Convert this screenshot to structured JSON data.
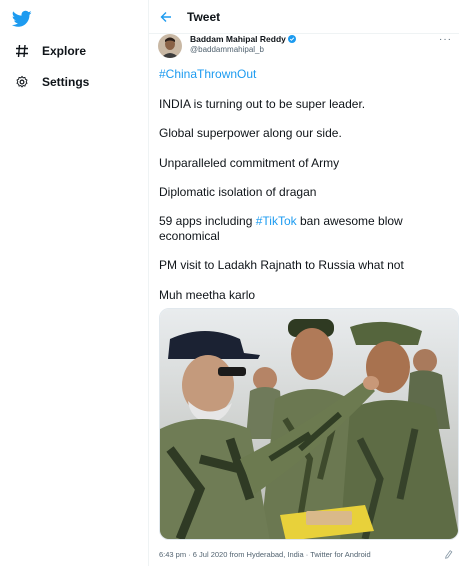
{
  "nav": {
    "items": [
      {
        "label": "Explore",
        "icon": "hash-icon"
      },
      {
        "label": "Settings",
        "icon": "gear-icon"
      }
    ]
  },
  "header": {
    "title": "Tweet"
  },
  "tweet": {
    "author_name": "Baddam Mahipal Reddy",
    "author_handle": "@baddammahipal_b",
    "hashtag_line": "#ChinaThrownOut",
    "lines": [
      "INDIA is turning out to be super leader.",
      "Global superpower along our side.",
      "Unparalleled commitment of Army",
      "Diplomatic isolation of dragan"
    ],
    "apps_prefix": "59 apps including ",
    "apps_link": "#TikTok",
    "apps_suffix": " ban awesome blow economical",
    "line_pm": "PM visit to Ladakh  Rajnath to Russia what not",
    "line_last": "Muh meetha karlo",
    "timestamp": "6:43 pm · 6 Jul 2020 from Hyderabad, India · Twitter for Android"
  },
  "colors": {
    "accent": "#1d9bf0",
    "text": "#0f1419",
    "muted": "#536471"
  }
}
